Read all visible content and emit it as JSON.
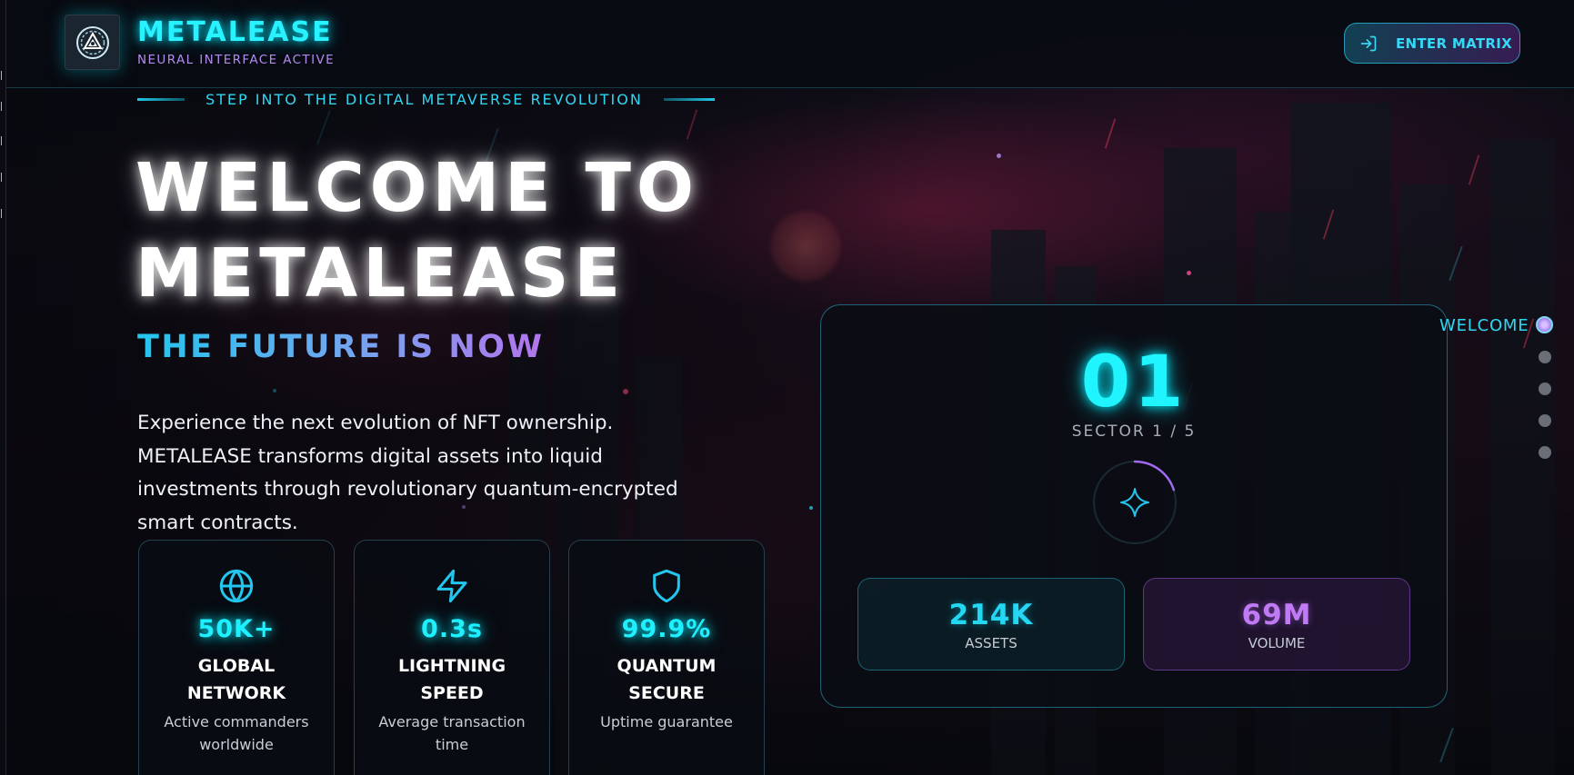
{
  "header": {
    "brand_name": "METALEASE",
    "brand_subtitle": "NEURAL INTERFACE ACTIVE",
    "logo_icon": "arc-reactor-icon",
    "cta_label": "ENTER MATRIX",
    "cta_icon": "sign-in-icon"
  },
  "hero": {
    "tagline": "STEP INTO THE DIGITAL METAVERSE REVOLUTION",
    "title_line1": "WELCOME TO",
    "title_line2": "METALEASE",
    "subtitle": "THE FUTURE IS NOW",
    "description": "Experience the next evolution of NFT ownership. METALEASE transforms digital assets into liquid investments through revolutionary quantum-encrypted smart contracts."
  },
  "features": [
    {
      "icon": "globe-icon",
      "value": "50K+",
      "title": "GLOBAL NETWORK",
      "desc": "Active commanders worldwide"
    },
    {
      "icon": "lightning-icon",
      "value": "0.3s",
      "title": "LIGHTNING SPEED",
      "desc": "Average transaction time"
    },
    {
      "icon": "shield-icon",
      "value": "99.9%",
      "title": "QUANTUM SECURE",
      "desc": "Uptime guarantee"
    }
  ],
  "sector_panel": {
    "number": "01",
    "label": "SECTOR 1 / 5",
    "center_icon": "sparkle-icon",
    "progress_fraction": 0.2,
    "stats": [
      {
        "value": "214K",
        "label": "ASSETS"
      },
      {
        "value": "69M",
        "label": "VOLUME"
      }
    ]
  },
  "section_nav": {
    "active_label": "WELCOME",
    "total": 5,
    "active_index": 0
  },
  "colors": {
    "accent_cyan": "#1ff0ff",
    "accent_purple": "#b574ee",
    "background": "#07090f"
  }
}
